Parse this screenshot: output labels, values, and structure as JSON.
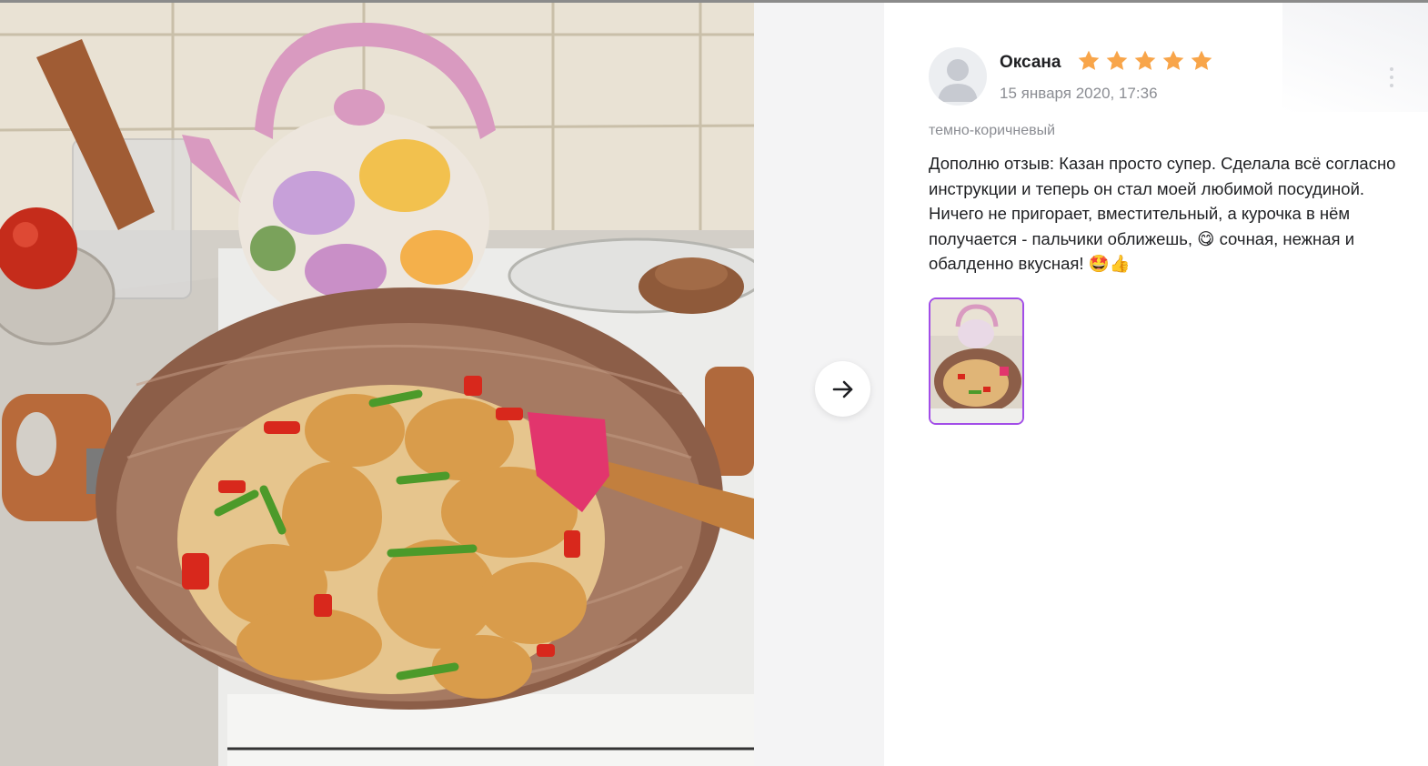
{
  "review": {
    "author": "Оксана",
    "rating": 5,
    "rating_max": 5,
    "date": "15 января 2020, 17:36",
    "variant": "темно-коричневый",
    "text": "Дополню отзыв: Казан просто супер. Сделала всё согласно инструкции и теперь он стал моей любимой посудиной. Ничего не пригорает, вместительный, а курочка в нём получается - пальчики оближешь, 😋 сочная, нежная и обалденно вкусная! 🤩👍",
    "photo_count": 1
  },
  "viewer": {
    "next_icon": "arrow-right-icon",
    "menu_icon": "more-vertical-icon"
  },
  "colors": {
    "star": "#f8a54a",
    "thumb_border": "#a24de8",
    "muted_text": "#8b8d93",
    "nav_bg": "#f4f4f5"
  }
}
